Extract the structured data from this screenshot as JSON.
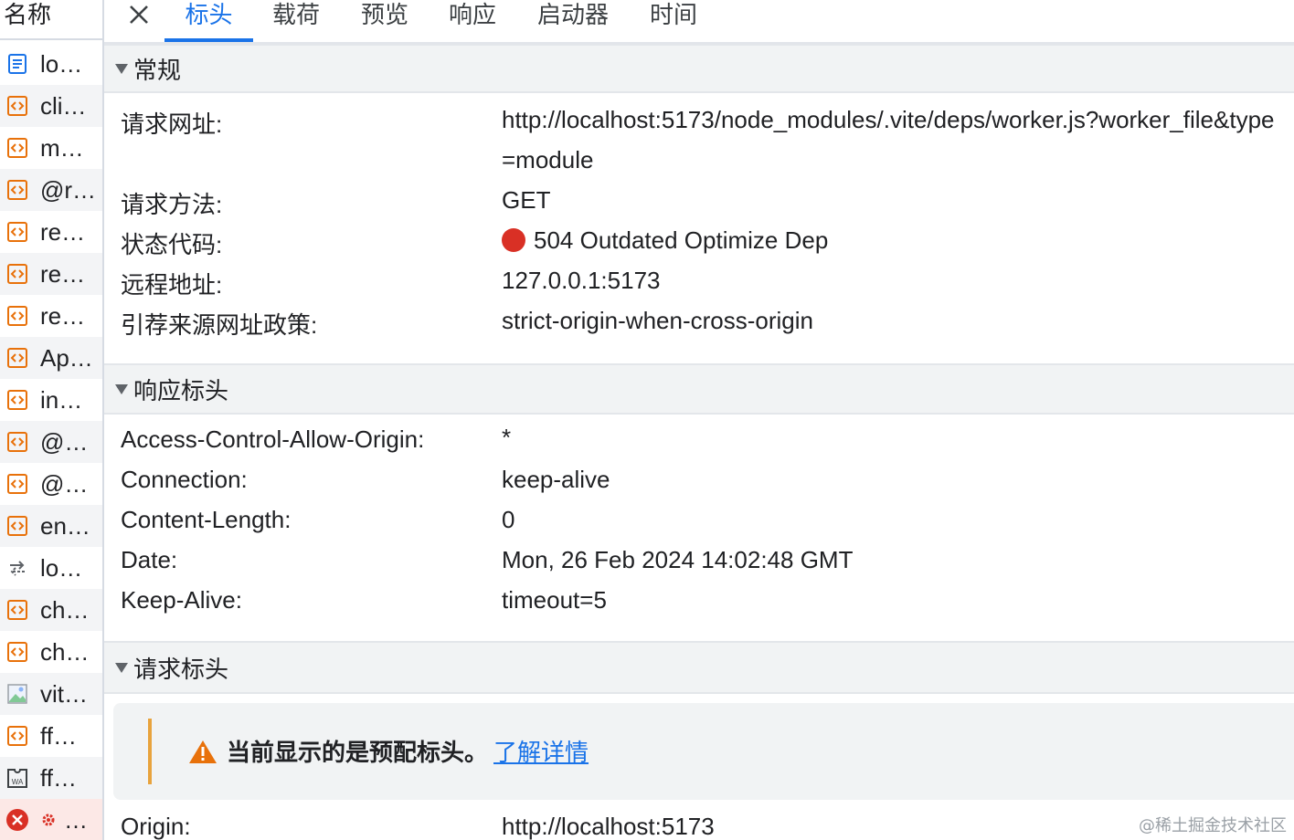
{
  "left_panel": {
    "header": "名称",
    "requests": [
      {
        "name": "lo…",
        "icon": "document-icon"
      },
      {
        "name": "cli…",
        "icon": "script-icon"
      },
      {
        "name": "m…",
        "icon": "script-icon"
      },
      {
        "name": "@r…",
        "icon": "script-icon"
      },
      {
        "name": "re…",
        "icon": "script-icon"
      },
      {
        "name": "re…",
        "icon": "script-icon"
      },
      {
        "name": "re…",
        "icon": "script-icon"
      },
      {
        "name": "Ap…",
        "icon": "script-icon"
      },
      {
        "name": "in…",
        "icon": "script-icon"
      },
      {
        "name": "@…",
        "icon": "script-icon"
      },
      {
        "name": "@…",
        "icon": "script-icon"
      },
      {
        "name": "en…",
        "icon": "script-icon"
      },
      {
        "name": "lo…",
        "icon": "websocket-icon"
      },
      {
        "name": "ch…",
        "icon": "script-icon"
      },
      {
        "name": "ch…",
        "icon": "script-icon"
      },
      {
        "name": "vit…",
        "icon": "image-icon"
      },
      {
        "name": "ff…",
        "icon": "script-icon"
      },
      {
        "name": "ff…",
        "icon": "wasm-icon"
      },
      {
        "name": "…",
        "icon": "error-icon"
      }
    ]
  },
  "tabs": [
    {
      "label": "标头",
      "active": true
    },
    {
      "label": "载荷",
      "active": false
    },
    {
      "label": "预览",
      "active": false
    },
    {
      "label": "响应",
      "active": false
    },
    {
      "label": "启动器",
      "active": false
    },
    {
      "label": "时间",
      "active": false
    }
  ],
  "general": {
    "title": "常规",
    "rows": [
      {
        "key": "请求网址:",
        "value": "http://localhost:5173/node_modules/.vite/deps/worker.js?worker_file&type",
        "value2": "=module"
      },
      {
        "key": "请求方法:",
        "value": "GET"
      },
      {
        "key": "状态代码:",
        "value": "504 Outdated Optimize Dep"
      },
      {
        "key": "远程地址:",
        "value": "127.0.0.1:5173"
      },
      {
        "key": "引荐来源网址政策:",
        "value": "strict-origin-when-cross-origin"
      }
    ]
  },
  "response_headers": {
    "title": "响应标头",
    "rows": [
      {
        "key": "Access-Control-Allow-Origin:",
        "value": "*"
      },
      {
        "key": "Connection:",
        "value": "keep-alive"
      },
      {
        "key": "Content-Length:",
        "value": "0"
      },
      {
        "key": "Date:",
        "value": "Mon, 26 Feb 2024 14:02:48 GMT"
      },
      {
        "key": "Keep-Alive:",
        "value": "timeout=5"
      }
    ]
  },
  "request_headers": {
    "title": "请求标头",
    "notice_text": "当前显示的是预配标头。",
    "notice_link": "了解详情",
    "rows": [
      {
        "key": "Origin:",
        "value": "http://localhost:5173"
      }
    ]
  },
  "watermark": "@稀土掘金技术社区",
  "colors": {
    "accent": "#1a73e8",
    "error": "#d93025",
    "warning": "#e8a33d",
    "script_icon": "#e8710a"
  }
}
